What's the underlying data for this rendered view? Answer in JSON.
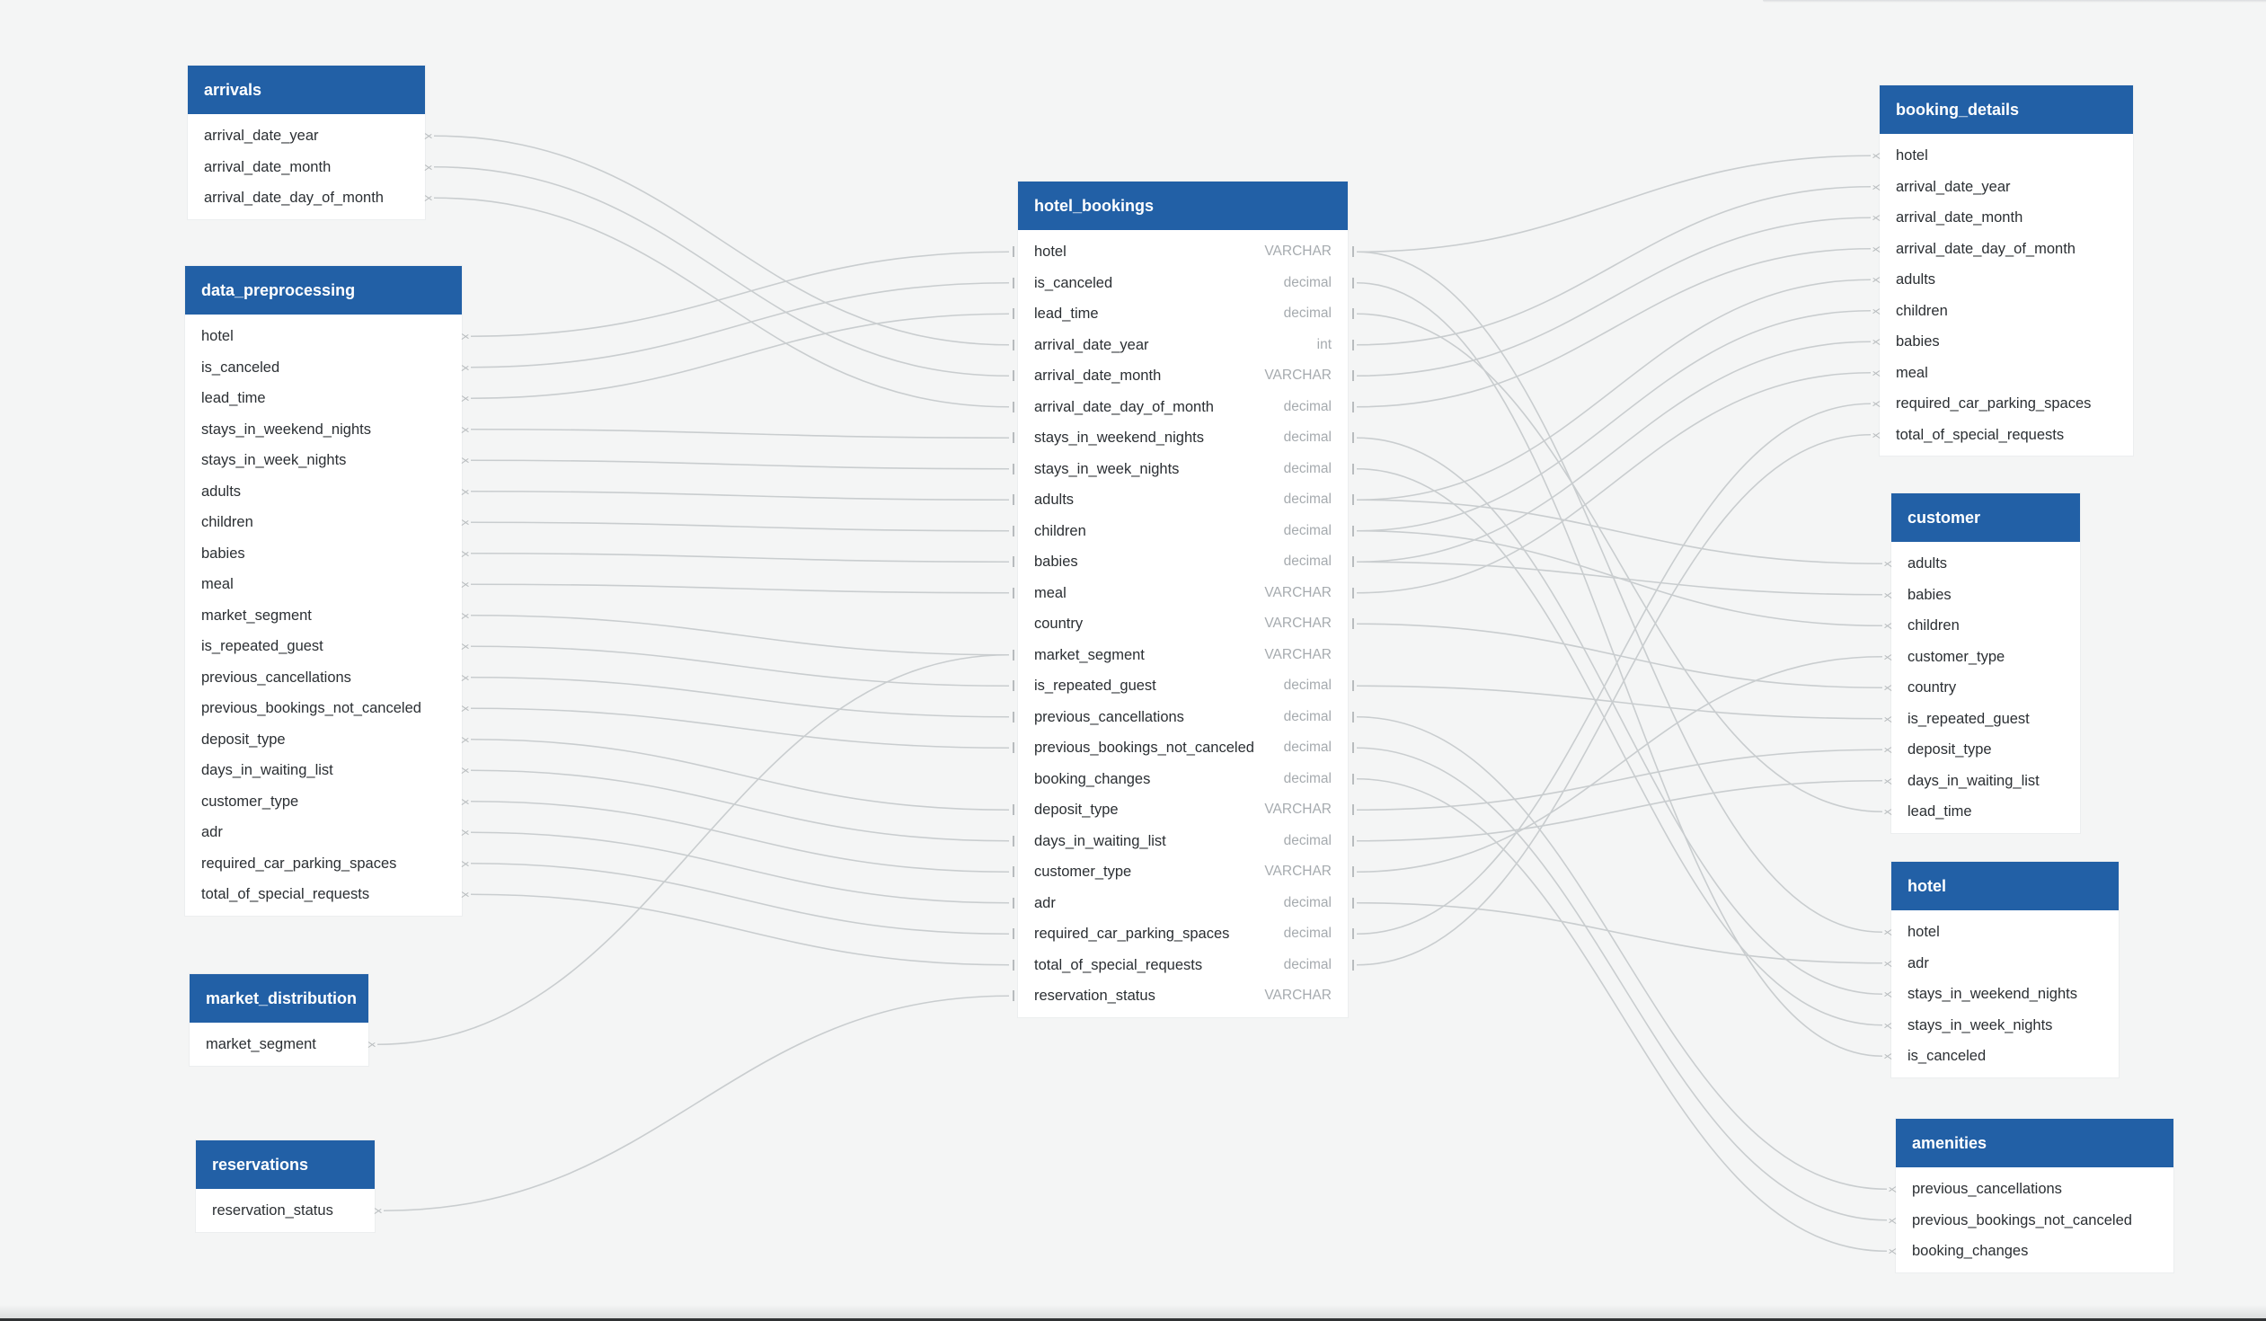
{
  "tables": [
    {
      "id": "arrivals",
      "title": "arrivals",
      "side": "left",
      "fields": [
        {
          "name": "arrival_date_year"
        },
        {
          "name": "arrival_date_month"
        },
        {
          "name": "arrival_date_day_of_month"
        }
      ]
    },
    {
      "id": "data_preprocessing",
      "title": "data_preprocessing",
      "side": "left",
      "fields": [
        {
          "name": "hotel"
        },
        {
          "name": "is_canceled"
        },
        {
          "name": "lead_time"
        },
        {
          "name": "stays_in_weekend_nights"
        },
        {
          "name": "stays_in_week_nights"
        },
        {
          "name": "adults"
        },
        {
          "name": "children"
        },
        {
          "name": "babies"
        },
        {
          "name": "meal"
        },
        {
          "name": "market_segment"
        },
        {
          "name": "is_repeated_guest"
        },
        {
          "name": "previous_cancellations"
        },
        {
          "name": "previous_bookings_not_canceled"
        },
        {
          "name": "deposit_type"
        },
        {
          "name": "days_in_waiting_list"
        },
        {
          "name": "customer_type"
        },
        {
          "name": "adr"
        },
        {
          "name": "required_car_parking_spaces"
        },
        {
          "name": "total_of_special_requests"
        }
      ]
    },
    {
      "id": "market_distribution",
      "title": "market_distribution",
      "side": "left",
      "fields": [
        {
          "name": "market_segment"
        }
      ]
    },
    {
      "id": "reservations",
      "title": "reservations",
      "side": "left",
      "fields": [
        {
          "name": "reservation_status"
        }
      ]
    },
    {
      "id": "hotel_bookings",
      "title": "hotel_bookings",
      "side": "center",
      "fields": [
        {
          "name": "hotel",
          "type": "VARCHAR"
        },
        {
          "name": "is_canceled",
          "type": "decimal"
        },
        {
          "name": "lead_time",
          "type": "decimal"
        },
        {
          "name": "arrival_date_year",
          "type": "int"
        },
        {
          "name": "arrival_date_month",
          "type": "VARCHAR"
        },
        {
          "name": "arrival_date_day_of_month",
          "type": "decimal"
        },
        {
          "name": "stays_in_weekend_nights",
          "type": "decimal"
        },
        {
          "name": "stays_in_week_nights",
          "type": "decimal"
        },
        {
          "name": "adults",
          "type": "decimal"
        },
        {
          "name": "children",
          "type": "decimal"
        },
        {
          "name": "babies",
          "type": "decimal"
        },
        {
          "name": "meal",
          "type": "VARCHAR"
        },
        {
          "name": "country",
          "type": "VARCHAR"
        },
        {
          "name": "market_segment",
          "type": "VARCHAR"
        },
        {
          "name": "is_repeated_guest",
          "type": "decimal"
        },
        {
          "name": "previous_cancellations",
          "type": "decimal"
        },
        {
          "name": "previous_bookings_not_canceled",
          "type": "decimal"
        },
        {
          "name": "booking_changes",
          "type": "decimal"
        },
        {
          "name": "deposit_type",
          "type": "VARCHAR"
        },
        {
          "name": "days_in_waiting_list",
          "type": "decimal"
        },
        {
          "name": "customer_type",
          "type": "VARCHAR"
        },
        {
          "name": "adr",
          "type": "decimal"
        },
        {
          "name": "required_car_parking_spaces",
          "type": "decimal"
        },
        {
          "name": "total_of_special_requests",
          "type": "decimal"
        },
        {
          "name": "reservation_status",
          "type": "VARCHAR"
        }
      ]
    },
    {
      "id": "booking_details",
      "title": "booking_details",
      "side": "right",
      "fields": [
        {
          "name": "hotel"
        },
        {
          "name": "arrival_date_year"
        },
        {
          "name": "arrival_date_month"
        },
        {
          "name": "arrival_date_day_of_month"
        },
        {
          "name": "adults"
        },
        {
          "name": "children"
        },
        {
          "name": "babies"
        },
        {
          "name": "meal"
        },
        {
          "name": "required_car_parking_spaces"
        },
        {
          "name": "total_of_special_requests"
        }
      ]
    },
    {
      "id": "customer",
      "title": "customer",
      "side": "right",
      "fields": [
        {
          "name": "adults"
        },
        {
          "name": "babies"
        },
        {
          "name": "children"
        },
        {
          "name": "customer_type"
        },
        {
          "name": "country"
        },
        {
          "name": "is_repeated_guest"
        },
        {
          "name": "deposit_type"
        },
        {
          "name": "days_in_waiting_list"
        },
        {
          "name": "lead_time"
        }
      ]
    },
    {
      "id": "hotel",
      "title": "hotel",
      "side": "right",
      "fields": [
        {
          "name": "hotel"
        },
        {
          "name": "adr"
        },
        {
          "name": "stays_in_weekend_nights"
        },
        {
          "name": "stays_in_week_nights"
        },
        {
          "name": "is_canceled"
        }
      ]
    },
    {
      "id": "amenities",
      "title": "amenities",
      "side": "right",
      "fields": [
        {
          "name": "previous_cancellations"
        },
        {
          "name": "previous_bookings_not_canceled"
        },
        {
          "name": "booking_changes"
        }
      ]
    }
  ],
  "relationships": [
    {
      "from": "arrivals",
      "to": "hotel_bookings",
      "fields": [
        "arrival_date_year",
        "arrival_date_month",
        "arrival_date_day_of_month"
      ]
    },
    {
      "from": "data_preprocessing",
      "to": "hotel_bookings",
      "fields": [
        "hotel",
        "is_canceled",
        "lead_time",
        "stays_in_weekend_nights",
        "stays_in_week_nights",
        "adults",
        "children",
        "babies",
        "meal",
        "market_segment",
        "is_repeated_guest",
        "previous_cancellations",
        "previous_bookings_not_canceled",
        "deposit_type",
        "days_in_waiting_list",
        "customer_type",
        "adr",
        "required_car_parking_spaces",
        "total_of_special_requests"
      ]
    },
    {
      "from": "market_distribution",
      "to": "hotel_bookings",
      "fields": [
        "market_segment"
      ]
    },
    {
      "from": "reservations",
      "to": "hotel_bookings",
      "fields": [
        "reservation_status"
      ]
    },
    {
      "from": "hotel_bookings",
      "to": "booking_details",
      "fields": [
        "hotel",
        "arrival_date_year",
        "arrival_date_month",
        "arrival_date_day_of_month",
        "adults",
        "children",
        "babies",
        "meal",
        "required_car_parking_spaces",
        "total_of_special_requests"
      ]
    },
    {
      "from": "hotel_bookings",
      "to": "customer",
      "fields": [
        "adults",
        "babies",
        "children",
        "customer_type",
        "country",
        "is_repeated_guest",
        "deposit_type",
        "days_in_waiting_list",
        "lead_time"
      ]
    },
    {
      "from": "hotel_bookings",
      "to": "hotel",
      "fields": [
        "hotel",
        "adr",
        "stays_in_weekend_nights",
        "stays_in_week_nights",
        "is_canceled"
      ]
    },
    {
      "from": "hotel_bookings",
      "to": "amenities",
      "fields": [
        "previous_cancellations",
        "previous_bookings_not_canceled",
        "booking_changes"
      ]
    }
  ],
  "colors": {
    "header": "#2260a6",
    "connector": "#c9cdcf",
    "background": "#f4f5f5"
  }
}
